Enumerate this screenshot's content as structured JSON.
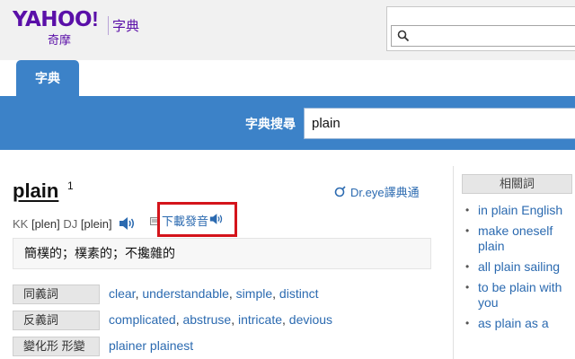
{
  "logo": {
    "brand": "YAHOO",
    "bang": "!",
    "sub": "奇摩",
    "section": "字典"
  },
  "top_search": {
    "value": ""
  },
  "tab": {
    "label": "字典"
  },
  "dict_search": {
    "label": "字典搜尋",
    "value": "plain"
  },
  "entry": {
    "word": "plain",
    "superscript": "1",
    "dreye_link": "Dr.eye譯典通",
    "kk_label": "KK",
    "kk_value": "[plen]",
    "dj_label": "DJ",
    "dj_value": "[plein]",
    "download_audio": "下載發音",
    "meaning": "簡樸的；樸素的；不攙雜的"
  },
  "rows": [
    {
      "label": "同義詞",
      "values": [
        "clear",
        "understandable",
        "simple",
        "distinct"
      ]
    },
    {
      "label": "反義詞",
      "values": [
        "complicated",
        "abstruse",
        "intricate",
        "devious"
      ]
    },
    {
      "label": "變化形 形變",
      "values": [
        "plainer plainest"
      ]
    }
  ],
  "related": {
    "title": "相關詞",
    "items": [
      "in plain English",
      "make oneself plain",
      "all plain sailing",
      "to be plain with you",
      "as plain as a"
    ]
  },
  "colors": {
    "brand_purple": "#5a0fa8",
    "blue": "#3c82c8",
    "link": "#2b6ab0",
    "highlight": "#d4141b"
  }
}
